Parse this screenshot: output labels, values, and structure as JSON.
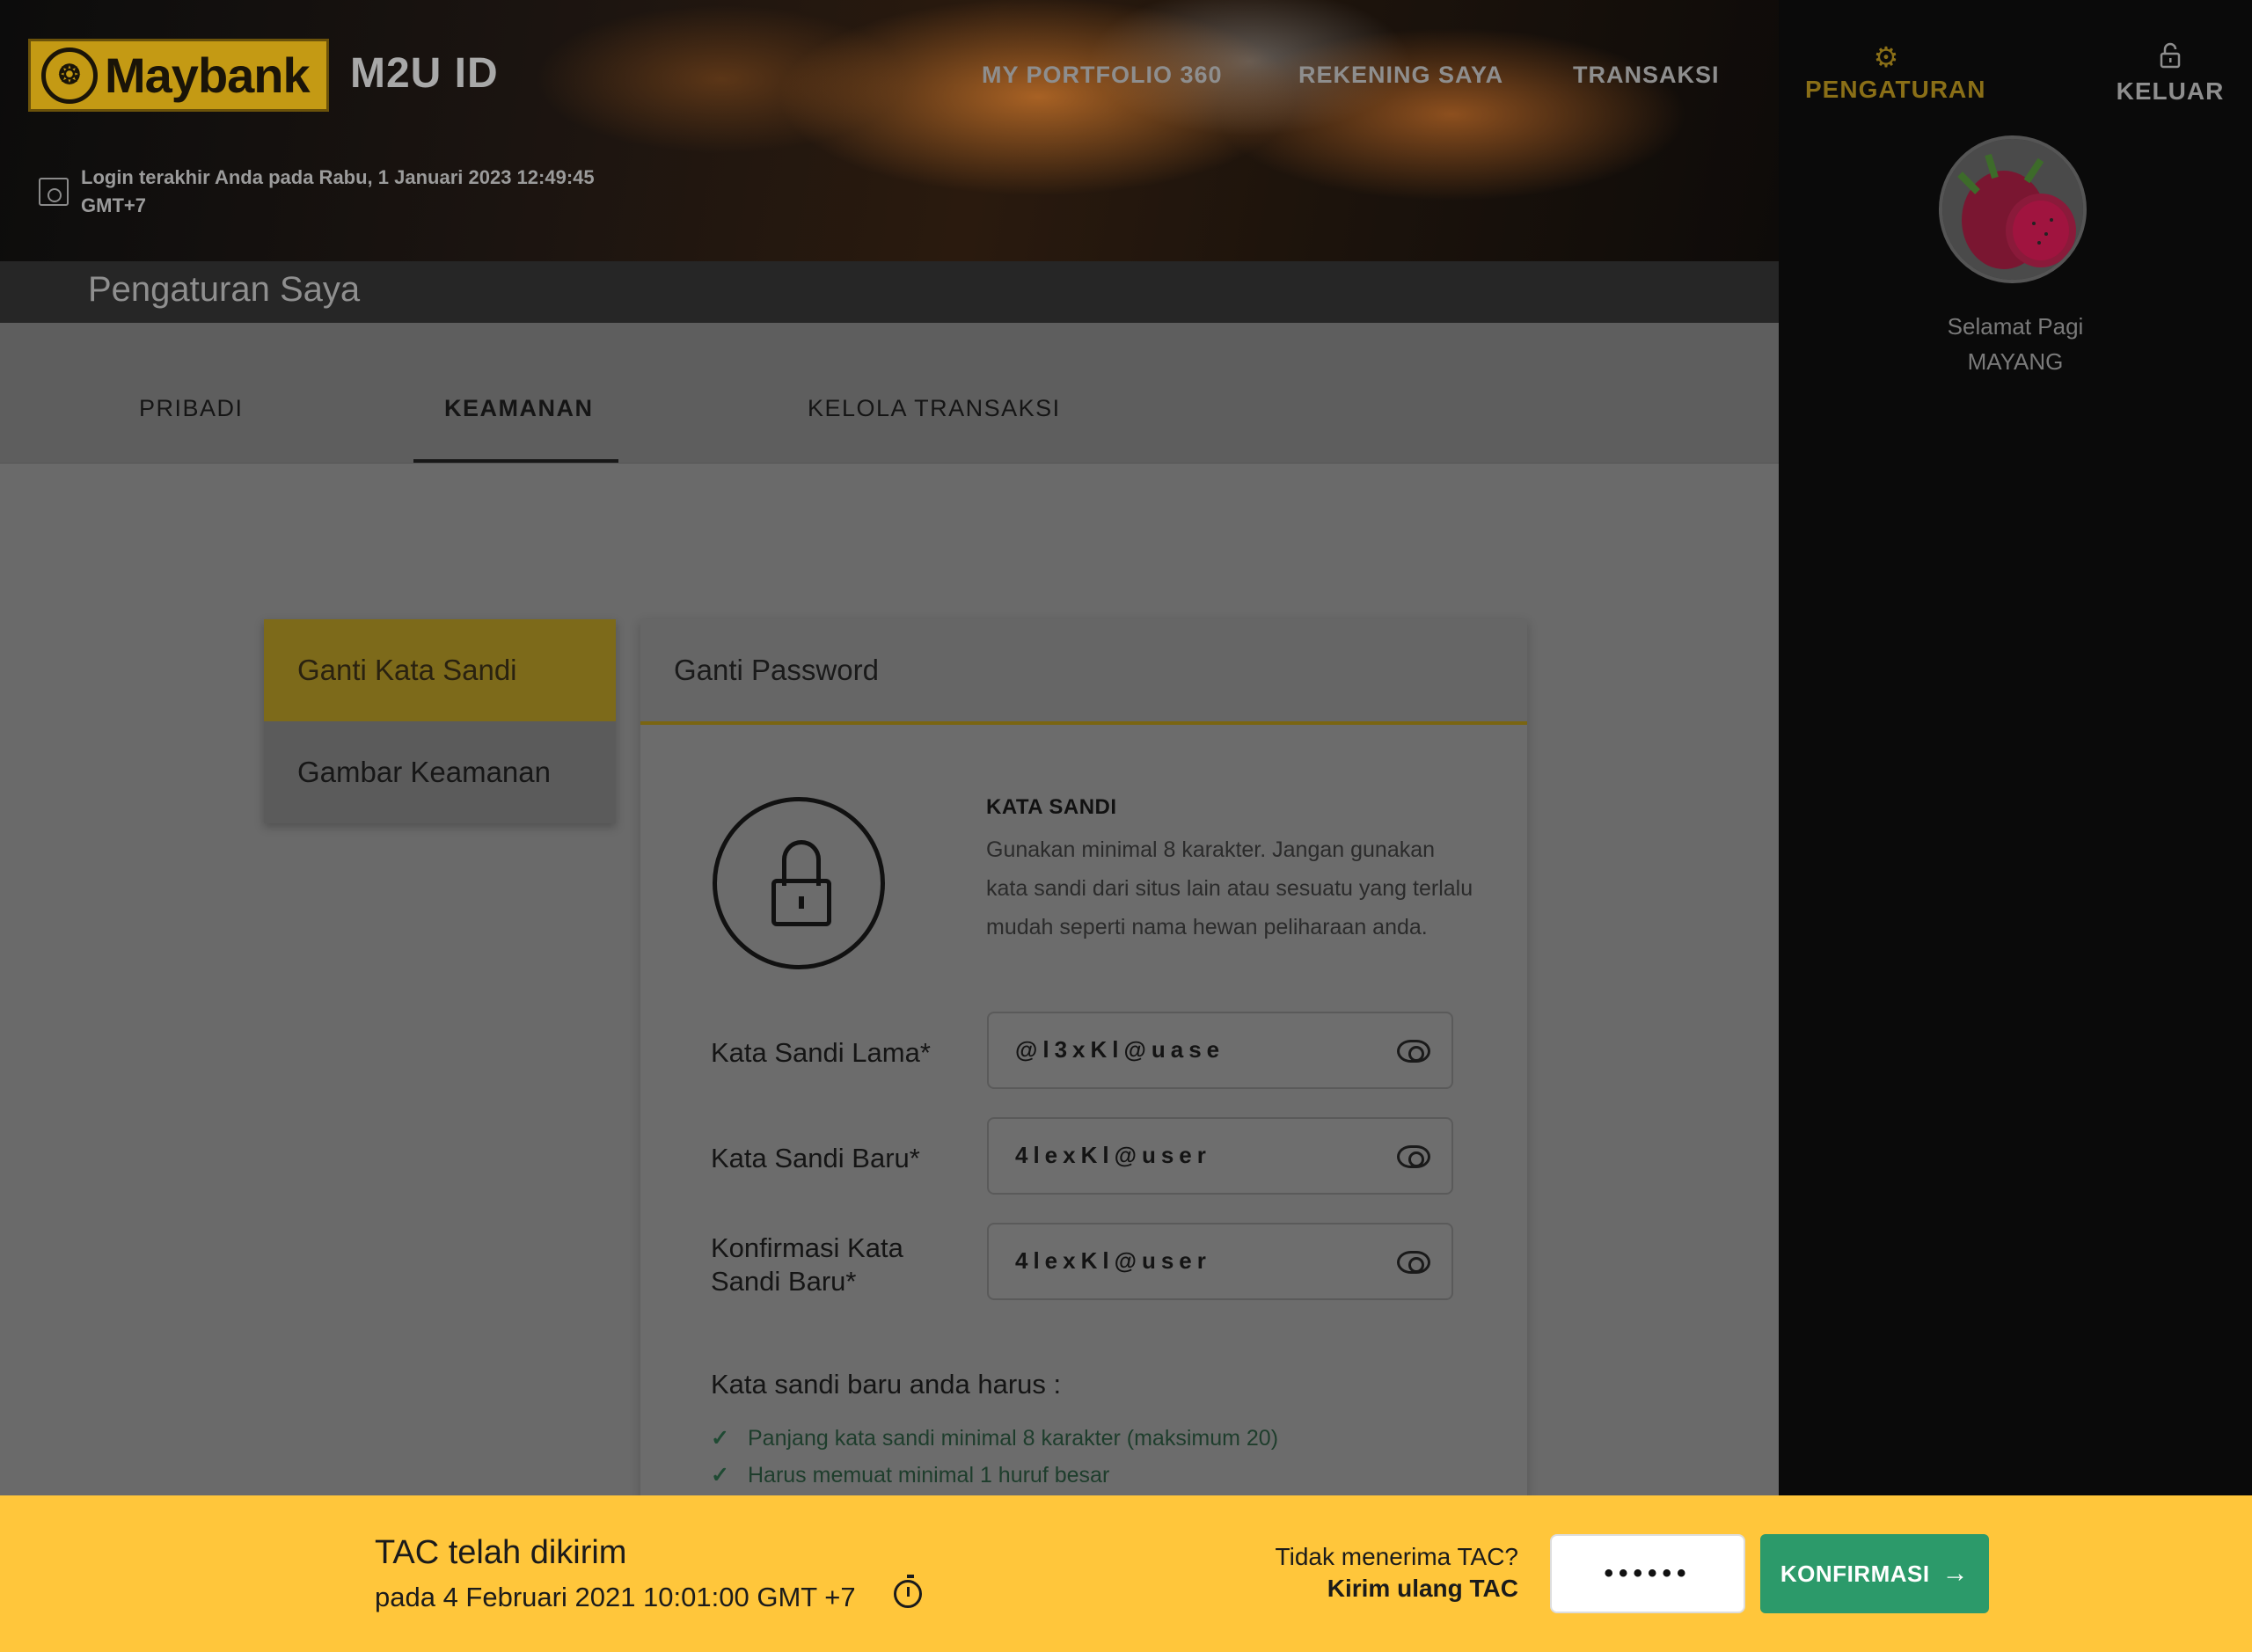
{
  "header": {
    "logo_text": "Maybank",
    "logo_mark": "❂",
    "brand_suffix": "M2U ID",
    "nav": [
      "MY PORTFOLIO 360",
      "REKENING SAYA",
      "TRANSAKSI"
    ],
    "last_login_line1": "Login terakhir Anda pada Rabu, 1 Januari 2023 12:49:45",
    "last_login_line2": "GMT+7"
  },
  "sidebar": {
    "settings_label": "PENGATURAN",
    "settings_icon": "gear-icon",
    "logout_label": "KELUAR",
    "logout_icon": "unlock-icon",
    "greeting": "Selamat Pagi",
    "user_name": "MAYANG",
    "accent_color": "#8a6f17"
  },
  "page": {
    "title": "Pengaturan Saya",
    "tabs": [
      "PRIBADI",
      "KEAMANAN",
      "KELOLA TRANSAKSI"
    ],
    "active_tab": "KEAMANAN"
  },
  "menu": {
    "items": [
      "Ganti Kata Sandi",
      "Gambar Keamanan"
    ],
    "active": "Ganti Kata Sandi"
  },
  "card": {
    "title": "Ganti Password",
    "section_title": "KATA SANDI",
    "section_desc": "Gunakan minimal 8 karakter. Jangan gunakan kata sandi dari situs lain atau sesuatu yang terlalu mudah seperti nama hewan peliharaan anda.",
    "fields": [
      {
        "label": "Kata Sandi Lama*",
        "value": "@l3xKl@uase"
      },
      {
        "label": "Kata Sandi Baru*",
        "value": "4lexKl@user"
      },
      {
        "label_line1": "Konfirmasi Kata",
        "label_line2": "Sandi Baru*",
        "value": "4lexKl@user"
      }
    ],
    "rules_title": "Kata sandi baru anda harus :",
    "rules": [
      "Panjang kata sandi minimal 8 karakter (maksimum 20)",
      "Harus memuat minimal 1 huruf besar"
    ]
  },
  "tac": {
    "title": "TAC telah dikirim",
    "sent_at": "pada 4 Februari 2021 10:01:00 GMT +7",
    "resend_question": "Tidak menerima TAC?",
    "resend_link": "Kirim ulang TAC",
    "input_value": "••••••",
    "confirm_label": "KONFIRMASI",
    "confirm_arrow": "→",
    "bar_color": "#ffc63b",
    "button_color": "#2c9a6a"
  }
}
